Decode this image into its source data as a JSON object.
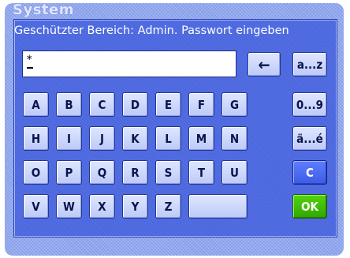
{
  "background_screen": {
    "title": "System"
  },
  "dialog": {
    "title": "Geschützter Bereich: Admin. Passwort eingeben",
    "input": {
      "value": "*"
    }
  },
  "keyboard": {
    "rows": [
      [
        "A",
        "B",
        "C",
        "D",
        "E",
        "F",
        "G"
      ],
      [
        "H",
        "I",
        "J",
        "K",
        "L",
        "M",
        "N"
      ],
      [
        "O",
        "P",
        "Q",
        "R",
        "S",
        "T",
        "U"
      ],
      [
        "V",
        "W",
        "X",
        "Y",
        "Z"
      ]
    ],
    "backspace": "←",
    "mode_lower": "a...z",
    "mode_digits": "0...9",
    "mode_special": "ä...é",
    "clear": "C",
    "ok": "OK"
  },
  "colors": {
    "dialog_bg": "#4c68df",
    "key_bg": "#c9d4fb",
    "clear_key": "#4864ee",
    "ok_key": "#3cbf00"
  }
}
